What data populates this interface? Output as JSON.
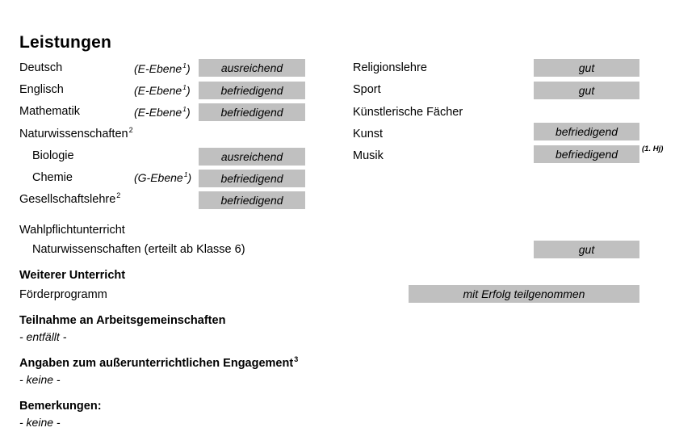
{
  "document": {
    "heading": "Leistungen",
    "accent_color": "#c0c0c0",
    "text_color": "#000000"
  },
  "left_column": {
    "rows": [
      {
        "subject": "Deutsch",
        "level": "(E-Ebene",
        "level_sup": "1",
        "level_close": ")",
        "grade": "ausreichend"
      },
      {
        "subject": "Englisch",
        "level": "(E-Ebene",
        "level_sup": "1",
        "level_close": ")",
        "grade": "befriedigend"
      },
      {
        "subject": "Mathematik",
        "level": "(E-Ebene",
        "level_sup": "1",
        "level_close": ")",
        "grade": "befriedigend"
      },
      {
        "subject": "Naturwissenschaften",
        "subject_sup": "2",
        "level": "",
        "grade": ""
      },
      {
        "subject": "Biologie",
        "level": "",
        "grade": "ausreichend"
      },
      {
        "subject": "Chemie",
        "level": "(G-Ebene",
        "level_sup": "1",
        "level_close": ")",
        "grade": "befriedigend"
      },
      {
        "subject": "Gesellschaftslehre",
        "subject_sup": "2",
        "level": "",
        "grade": "befriedigend"
      }
    ]
  },
  "right_column": {
    "rows": [
      {
        "subject": "Religionslehre",
        "grade": "gut"
      },
      {
        "subject": "Sport",
        "grade": "gut"
      },
      {
        "subject": "Künstlerische Fächer",
        "grade": ""
      },
      {
        "subject": "Kunst",
        "grade": "befriedigend"
      },
      {
        "subject": "Musik",
        "grade": "befriedigend",
        "annotation": "(1. Hj)"
      }
    ]
  },
  "elective": {
    "header": "Wahlpflichtunterricht",
    "item": "Naturwissenschaften (erteilt ab Klasse 6)",
    "grade": "gut"
  },
  "further_instruction": {
    "header": "Weiterer Unterricht",
    "item": "Förderprogramm",
    "grade": "mit Erfolg teilgenommen"
  },
  "working_groups": {
    "header": "Teilnahme an Arbeitsgemeinschaften",
    "value": "- entfällt -"
  },
  "engagement": {
    "header": "Angaben zum außerunterrichtlichen Engagement",
    "header_sup": "3",
    "value": "- keine -"
  },
  "remarks": {
    "header": "Bemerkungen:",
    "value": "- keine -"
  }
}
